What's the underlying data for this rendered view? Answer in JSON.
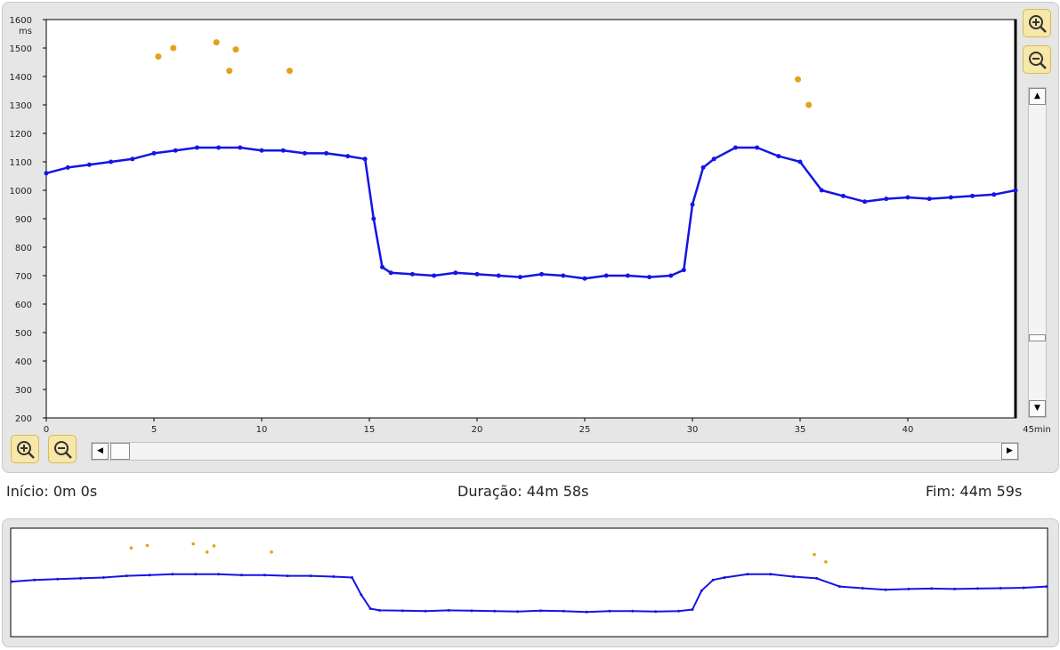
{
  "labels": {
    "start": "Início: 0m 0s",
    "duration": "Duração: 44m 58s",
    "end": "Fim: 44m 59s"
  },
  "colors": {
    "series": "#1414e6",
    "outlier": "#e3a21a",
    "panel": "#e6e6e6",
    "button": "#f7e7a8"
  },
  "icons": {
    "zoom_in": "zoom-in-icon",
    "zoom_out": "zoom-out-icon",
    "arrow_up": "▲",
    "arrow_down": "▼",
    "arrow_left": "◀",
    "arrow_right": "▶"
  },
  "chart_data": {
    "type": "line",
    "y_unit_label": "ms",
    "x_unit_label": "45min",
    "ylim": [
      200,
      1600
    ],
    "xlim": [
      0,
      45
    ],
    "y_ticks": [
      200,
      300,
      400,
      500,
      600,
      700,
      800,
      900,
      1000,
      1100,
      1200,
      1300,
      1400,
      1500,
      1600
    ],
    "x_ticks": [
      0,
      5,
      10,
      15,
      20,
      25,
      30,
      35,
      40
    ],
    "grid": false,
    "series": [
      {
        "x": [
          0,
          1,
          2,
          3,
          4,
          5,
          6,
          7,
          8,
          9,
          10,
          11,
          12,
          13,
          14,
          14.8,
          15.2,
          15.6,
          16,
          17,
          18,
          19,
          20,
          21,
          22,
          23,
          24,
          25,
          26,
          27,
          28,
          29,
          29.6,
          30,
          30.5,
          31,
          32,
          33,
          34,
          35,
          36,
          37,
          38,
          39,
          40,
          41,
          42,
          43,
          44,
          45
        ],
        "values": [
          1060,
          1080,
          1090,
          1100,
          1110,
          1130,
          1140,
          1150,
          1150,
          1150,
          1140,
          1140,
          1130,
          1130,
          1120,
          1110,
          900,
          730,
          710,
          705,
          700,
          710,
          705,
          700,
          695,
          705,
          700,
          690,
          700,
          700,
          695,
          700,
          720,
          950,
          1080,
          1110,
          1150,
          1150,
          1120,
          1100,
          1000,
          980,
          960,
          970,
          975,
          970,
          975,
          980,
          985,
          1000
        ]
      }
    ],
    "outliers": [
      {
        "x": 5.2,
        "y": 1470
      },
      {
        "x": 5.9,
        "y": 1500
      },
      {
        "x": 7.9,
        "y": 1520
      },
      {
        "x": 8.5,
        "y": 1420
      },
      {
        "x": 8.8,
        "y": 1495
      },
      {
        "x": 11.3,
        "y": 1420
      },
      {
        "x": 34.9,
        "y": 1390
      },
      {
        "x": 35.4,
        "y": 1300
      }
    ]
  }
}
